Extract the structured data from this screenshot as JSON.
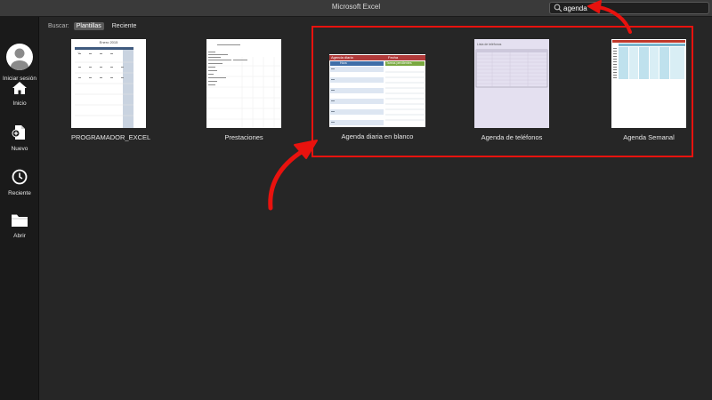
{
  "window": {
    "title": "Microsoft Excel"
  },
  "search": {
    "value": "agenda"
  },
  "sidebar": {
    "account_label": "Iniciar sesión",
    "items": [
      {
        "label": "Inicio",
        "icon": "home-icon"
      },
      {
        "label": "Nuevo",
        "icon": "new-document-icon"
      },
      {
        "label": "Reciente",
        "icon": "clock-icon"
      },
      {
        "label": "Abrir",
        "icon": "folder-icon"
      }
    ]
  },
  "filter": {
    "label": "Buscar:",
    "tabs": [
      {
        "label": "Plantillas",
        "selected": true
      },
      {
        "label": "Reciente",
        "selected": false
      }
    ]
  },
  "templates": [
    {
      "label": "PROGRAMADOR_EXCEL",
      "thumb_title": "Enero 2015"
    },
    {
      "label": "Prestaciones"
    },
    {
      "label": "Agenda diaria en blanco",
      "thumb_header_left": "Agenda diaria",
      "thumb_header_right": "Fecha",
      "thumb_sub_left": "Hora",
      "thumb_sub_right": "Tareas pendientes"
    },
    {
      "label": "Agenda de teléfonos",
      "thumb_title": "Lista de teléfonos"
    },
    {
      "label": "Agenda Semanal"
    }
  ],
  "colors": {
    "highlight": "#e8120e",
    "annotation_arrow": "#e8120e",
    "agenda_header": "#b03a3a",
    "agenda_hour_header": "#3f6ea8",
    "agenda_tasks_header": "#79a83f",
    "phonebook_background": "#e4e0f0",
    "weekly_header": "#a0cfe0"
  }
}
